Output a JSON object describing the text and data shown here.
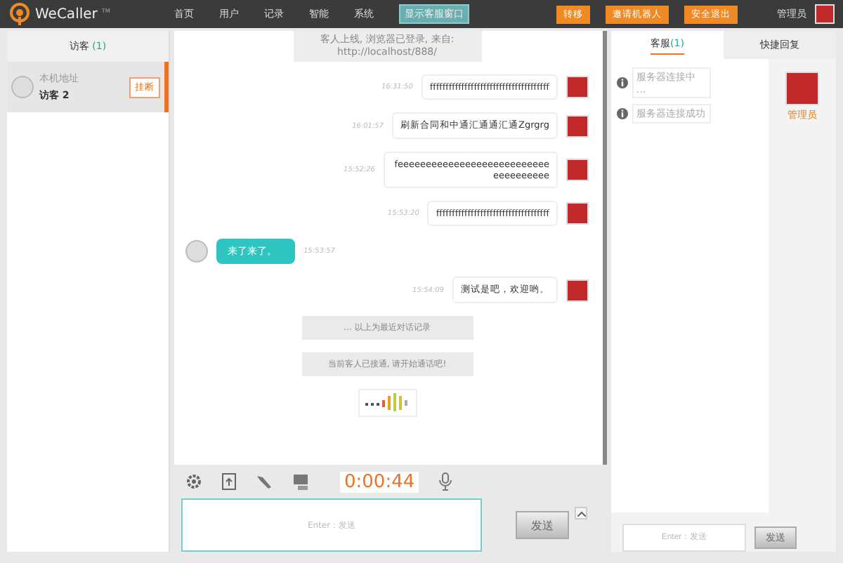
{
  "header": {
    "logo": "WeCaller",
    "logo_mark": "TM",
    "nav": [
      {
        "label": "首页",
        "selected": false
      },
      {
        "label": "用户",
        "selected": false
      },
      {
        "label": "记录",
        "selected": false
      },
      {
        "label": "智能",
        "selected": false
      },
      {
        "label": "系统",
        "selected": false
      }
    ],
    "toggle": "显示客服窗口",
    "buttons": [
      "转移",
      "邀请机器人",
      "安全退出"
    ],
    "user": "管理员"
  },
  "left": {
    "tab": {
      "label": "访客",
      "count": "(1)"
    },
    "visitors": [
      {
        "address": "本机地址",
        "name": "访客 2",
        "action": "挂断",
        "selected": true
      }
    ]
  },
  "messages": [
    {
      "kind": "system",
      "lines": [
        "客人上线, 浏览器已登录, 来自:",
        "http://localhost/888/"
      ]
    },
    {
      "kind": "agent",
      "time": "16:31:50",
      "text": "ffffffffffffffffffffffffffffffffffffff"
    },
    {
      "kind": "agent",
      "time": "16:01:57",
      "text": "刷新合同和中通汇通通汇通Zgrgrg"
    },
    {
      "kind": "agent",
      "time": "15:52:26",
      "text": "feeeeeeeeeeeeeeeeeeeeeeeeeeeeeeeeeeeee"
    },
    {
      "kind": "agent",
      "time": "15:53:20",
      "text": "ffffffffffffffffffffffffffffffffffff"
    },
    {
      "kind": "visitor",
      "time": "15:53:57",
      "text": "来了来了。"
    },
    {
      "kind": "agent",
      "time": "15:54:09",
      "text": "测试是吧，欢迎哟。"
    },
    {
      "kind": "notice",
      "text": "... 以上为最近对话记录"
    },
    {
      "kind": "notice",
      "text": "当前客人已接通, 请开始通话吧!"
    },
    {
      "kind": "audio"
    }
  ],
  "toolbar": {
    "timer": "0:00:44"
  },
  "input": {
    "placeholder": "Enter：发送",
    "send": "发送"
  },
  "right": {
    "tabs": [
      {
        "label": "客服",
        "count": "(1)",
        "selected": true
      },
      {
        "label": "快捷回复",
        "selected": false
      }
    ],
    "statuses": [
      "服务器连接中 ...",
      "服务器连接成功"
    ],
    "agent": "管理员",
    "input": {
      "placeholder": "Enter：发送",
      "send": "发送"
    }
  }
}
